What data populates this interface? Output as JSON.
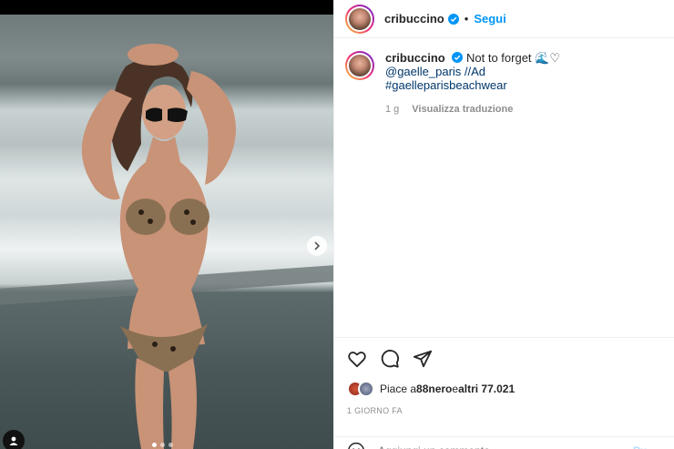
{
  "header": {
    "username": "cribuccino",
    "separator": "•",
    "follow_label": "Segui"
  },
  "caption": {
    "username": "cribuccino",
    "text": "Not to forget 🌊♡",
    "mention": "@gaelle_paris //Ad",
    "hashtag": "#gaelleparisbeachwear",
    "time": "1 g",
    "translate_label": "Visualizza traduzione"
  },
  "likes": {
    "prefix": "Piace a ",
    "user": "88nero",
    "middle": " e ",
    "others": "altri 77.021"
  },
  "date": "1 GIORNO FA",
  "comment": {
    "placeholder": "Aggiungi un commento...",
    "post_label": "Pu"
  },
  "carousel": {
    "dots": 3,
    "active_index": 0
  },
  "colors": {
    "accent": "#0095f6",
    "link": "#00376b",
    "muted": "#8e8e8e",
    "verified": "#0095f6"
  },
  "icons": {
    "like": "heart-icon",
    "comment": "comment-icon",
    "share": "paper-plane-icon",
    "next": "chevron-right-icon",
    "tag": "user-tag-icon",
    "emoji": "emoji-icon",
    "verified": "verified-badge-icon"
  }
}
